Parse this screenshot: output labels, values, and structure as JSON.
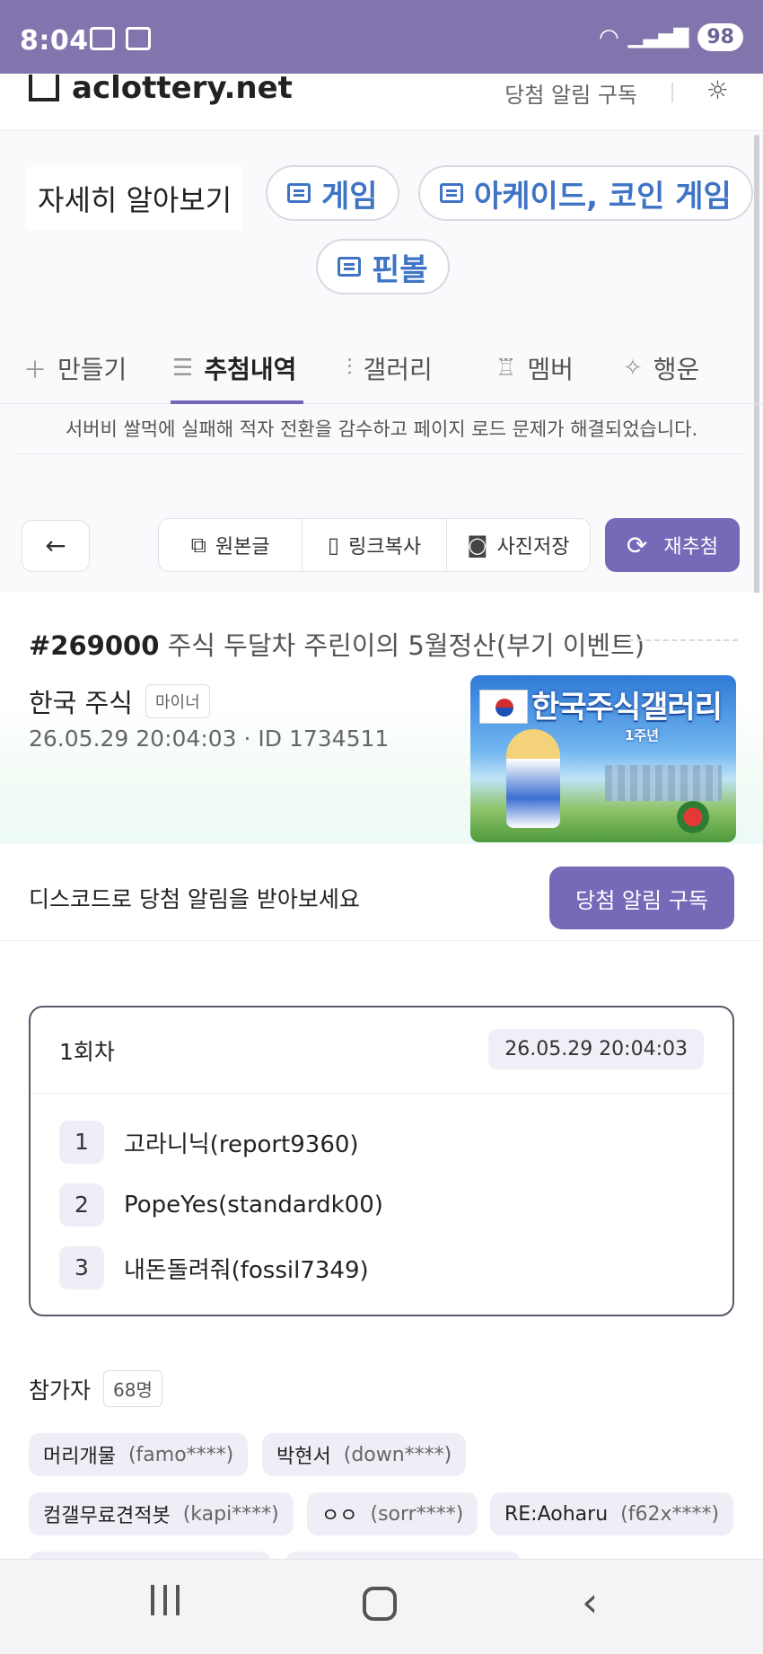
{
  "status_bar": {
    "time": "8:04",
    "battery": "98",
    "signal_label": "6"
  },
  "header": {
    "logo": "aclottery.net",
    "subscribe_link": "당첨 알림 구독"
  },
  "promo": {
    "learn_more": "자세히 알아보기",
    "chips": [
      "게임",
      "아케이드, 코인 게임",
      "핀볼"
    ]
  },
  "tabs": [
    {
      "label": "만들기",
      "icon": "plus-icon"
    },
    {
      "label": "추첨내역",
      "icon": "list-icon",
      "active": true
    },
    {
      "label": "갤러리",
      "icon": "bar-chart-icon"
    },
    {
      "label": "멤버",
      "icon": "trophy-icon"
    },
    {
      "label": "행운",
      "icon": "sparkle-icon"
    }
  ],
  "notice": "서버비 쌀먹에 실패해 적자 전환을 감수하고 페이지 로드 문제가 해결되었습니다.",
  "toolbar": {
    "original": "원본글",
    "copy_link": "링크복사",
    "save_image": "사진저장",
    "redraw": "재추첨"
  },
  "post": {
    "number": "#269000",
    "title": "주식 두달차 주린이의 5월정산(부기 이벤트)",
    "gallery": "한국 주식",
    "gallery_badge": "마이너",
    "meta": "26.05.29 20:04:03 · ID 1734511",
    "thumbnail_title": "한국주식갤러리",
    "thumbnail_subtitle": "1주년"
  },
  "discord": {
    "text": "디스코드로 당첨 알림을 받아보세요",
    "button": "당첨 알림 구독"
  },
  "round": {
    "label": "1회차",
    "time": "26.05.29 20:04:03",
    "winners": [
      {
        "rank": "1",
        "name": "고라니닉(report9360)"
      },
      {
        "rank": "2",
        "name": "PopeYes(standardk00)"
      },
      {
        "rank": "3",
        "name": "내돈돌려줘(fossil7349)"
      }
    ]
  },
  "participants": {
    "label": "참가자",
    "count": "68명",
    "list": [
      {
        "name": "머리개물",
        "id": "(famo****)"
      },
      {
        "name": "박현서",
        "id": "(down****)"
      },
      {
        "name": "컴갤무료견적봇",
        "id": "(kapi****)"
      },
      {
        "name": "ㅇㅇ",
        "id": "(sorr****)"
      },
      {
        "name": "RE:Aoharu",
        "id": "(f62x****)"
      }
    ]
  },
  "colors": {
    "accent": "#7868b8",
    "status_bar": "#8275ad",
    "link_blue": "#3f74c5"
  }
}
